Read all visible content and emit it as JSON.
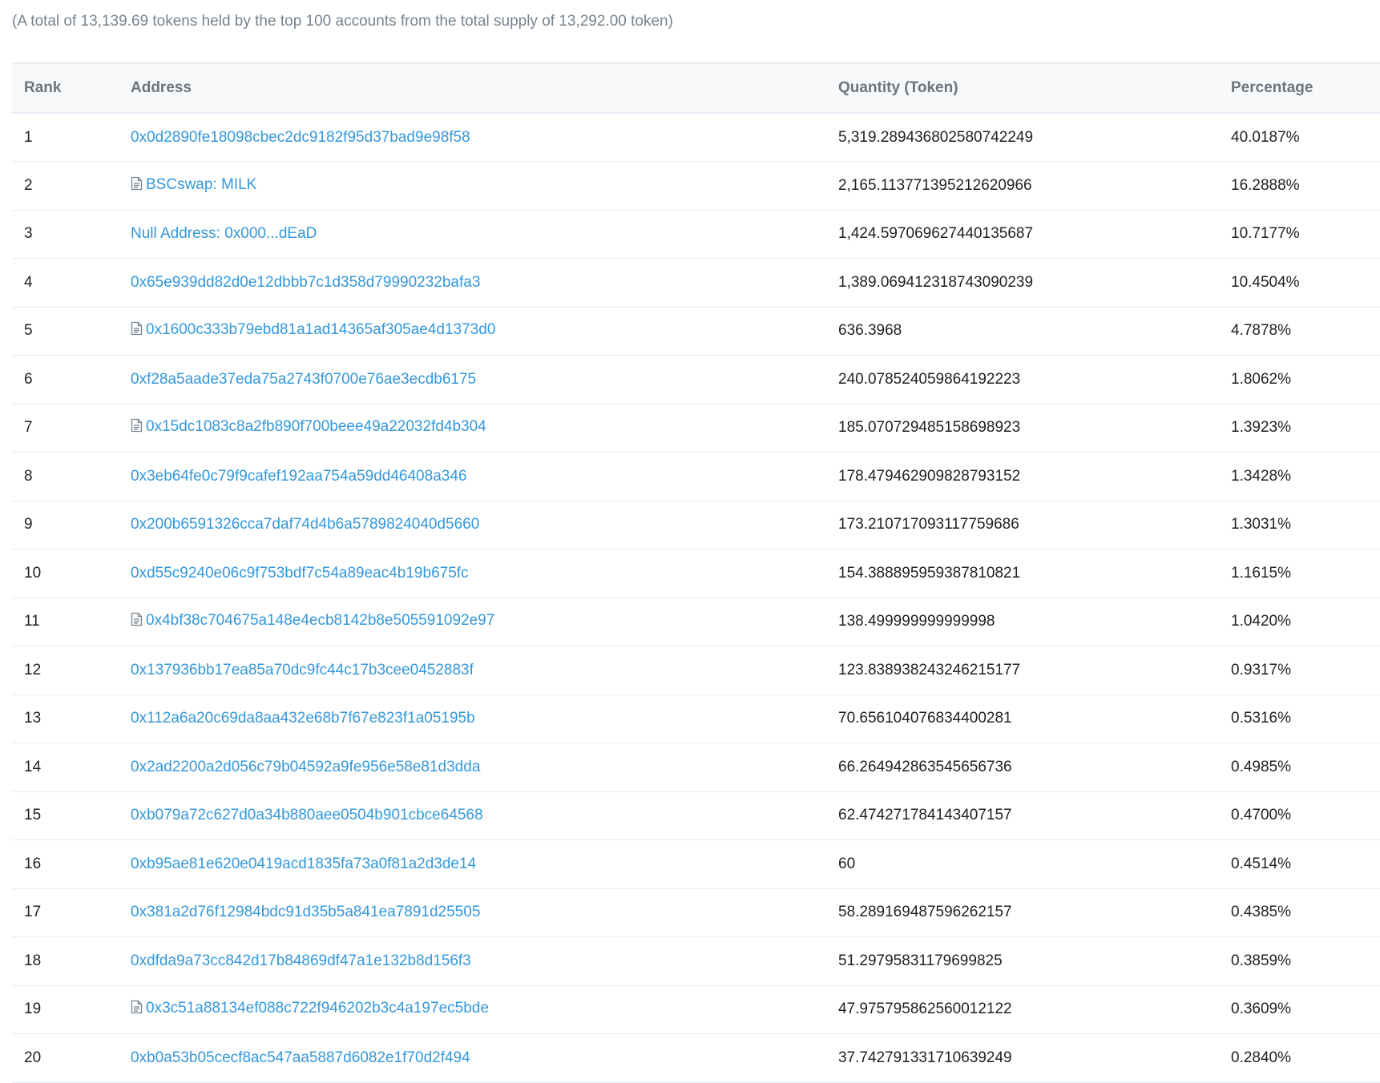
{
  "summary": "(A total of 13,139.69 tokens held by the top 100 accounts from the total supply of 13,292.00 token)",
  "columns": {
    "rank": "Rank",
    "address": "Address",
    "quantity": "Quantity (Token)",
    "percentage": "Percentage"
  },
  "icon_names": {
    "contract": "file-text-icon"
  },
  "colors": {
    "link": "#3498db",
    "muted": "#77838f",
    "text": "#1e2022",
    "border": "#e7eaf3",
    "header_bg": "#f8f9fa"
  },
  "rows": [
    {
      "rank": "1",
      "address": "0x0d2890fe18098cbec2dc9182f95d37bad9e98f58",
      "contract": false,
      "quantity": "5,319.289436802580742249",
      "percentage": "40.0187%"
    },
    {
      "rank": "2",
      "address": "BSCswap: MILK",
      "contract": true,
      "quantity": "2,165.113771395212620966",
      "percentage": "16.2888%"
    },
    {
      "rank": "3",
      "address": "Null Address: 0x000...dEaD",
      "contract": false,
      "quantity": "1,424.597069627440135687",
      "percentage": "10.7177%"
    },
    {
      "rank": "4",
      "address": "0x65e939dd82d0e12dbbb7c1d358d79990232bafa3",
      "contract": false,
      "quantity": "1,389.069412318743090239",
      "percentage": "10.4504%"
    },
    {
      "rank": "5",
      "address": "0x1600c333b79ebd81a1ad14365af305ae4d1373d0",
      "contract": true,
      "quantity": "636.3968",
      "percentage": "4.7878%"
    },
    {
      "rank": "6",
      "address": "0xf28a5aade37eda75a2743f0700e76ae3ecdb6175",
      "contract": false,
      "quantity": "240.078524059864192223",
      "percentage": "1.8062%"
    },
    {
      "rank": "7",
      "address": "0x15dc1083c8a2fb890f700beee49a22032fd4b304",
      "contract": true,
      "quantity": "185.070729485158698923",
      "percentage": "1.3923%"
    },
    {
      "rank": "8",
      "address": "0x3eb64fe0c79f9cafef192aa754a59dd46408a346",
      "contract": false,
      "quantity": "178.479462909828793152",
      "percentage": "1.3428%"
    },
    {
      "rank": "9",
      "address": "0x200b6591326cca7daf74d4b6a5789824040d5660",
      "contract": false,
      "quantity": "173.210717093117759686",
      "percentage": "1.3031%"
    },
    {
      "rank": "10",
      "address": "0xd55c9240e06c9f753bdf7c54a89eac4b19b675fc",
      "contract": false,
      "quantity": "154.388895959387810821",
      "percentage": "1.1615%"
    },
    {
      "rank": "11",
      "address": "0x4bf38c704675a148e4ecb8142b8e505591092e97",
      "contract": true,
      "quantity": "138.499999999999998",
      "percentage": "1.0420%"
    },
    {
      "rank": "12",
      "address": "0x137936bb17ea85a70dc9fc44c17b3cee0452883f",
      "contract": false,
      "quantity": "123.838938243246215177",
      "percentage": "0.9317%"
    },
    {
      "rank": "13",
      "address": "0x112a6a20c69da8aa432e68b7f67e823f1a05195b",
      "contract": false,
      "quantity": "70.656104076834400281",
      "percentage": "0.5316%"
    },
    {
      "rank": "14",
      "address": "0x2ad2200a2d056c79b04592a9fe956e58e81d3dda",
      "contract": false,
      "quantity": "66.264942863545656736",
      "percentage": "0.4985%"
    },
    {
      "rank": "15",
      "address": "0xb079a72c627d0a34b880aee0504b901cbce64568",
      "contract": false,
      "quantity": "62.474271784143407157",
      "percentage": "0.4700%"
    },
    {
      "rank": "16",
      "address": "0xb95ae81e620e0419acd1835fa73a0f81a2d3de14",
      "contract": false,
      "quantity": "60",
      "percentage": "0.4514%"
    },
    {
      "rank": "17",
      "address": "0x381a2d76f12984bdc91d35b5a841ea7891d25505",
      "contract": false,
      "quantity": "58.289169487596262157",
      "percentage": "0.4385%"
    },
    {
      "rank": "18",
      "address": "0xdfda9a73cc842d17b84869df47a1e132b8d156f3",
      "contract": false,
      "quantity": "51.29795831179699825",
      "percentage": "0.3859%"
    },
    {
      "rank": "19",
      "address": "0x3c51a88134ef088c722f946202b3c4a197ec5bde",
      "contract": true,
      "quantity": "47.975795862560012122",
      "percentage": "0.3609%"
    },
    {
      "rank": "20",
      "address": "0xb0a53b05cecf8ac547aa5887d6082e1f70d2f494",
      "contract": false,
      "quantity": "37.742791331710639249",
      "percentage": "0.2840%"
    }
  ]
}
